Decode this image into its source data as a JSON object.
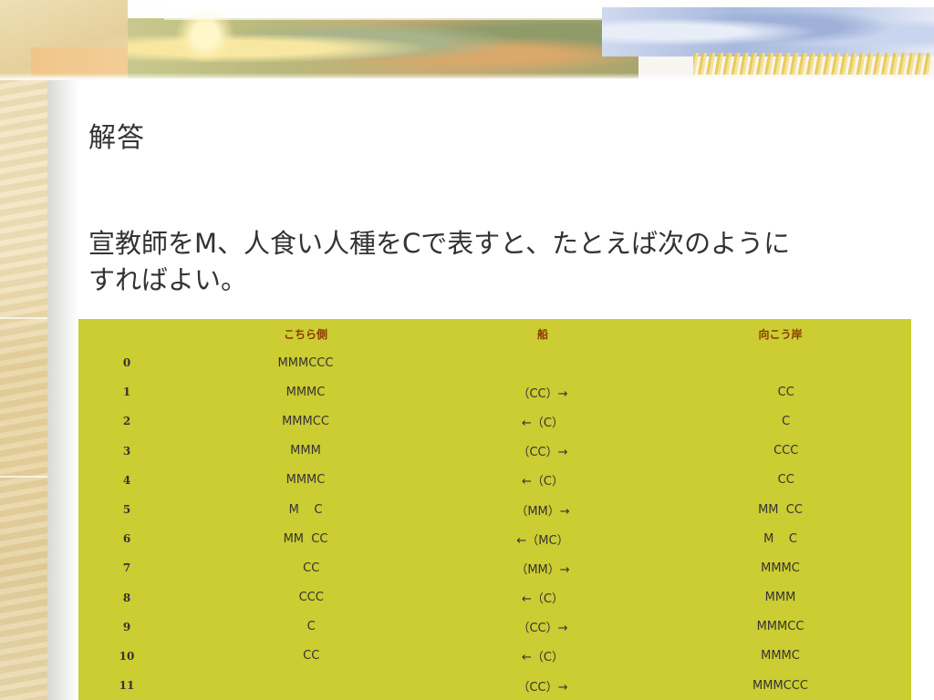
{
  "slide": {
    "title": "解答",
    "body_line1": "宣教師をM、人食い人種をCで表すと、たとえば次のように",
    "body_line2": "すればよい。"
  },
  "table": {
    "headers": [
      "",
      "こちら側",
      "船",
      "向こう岸"
    ],
    "rows": [
      {
        "step": "0",
        "here": "MMMCCC",
        "boat": "",
        "there": ""
      },
      {
        "step": "1",
        "here": "MMMC",
        "boat": "（CC）→",
        "there": "   CC"
      },
      {
        "step": "2",
        "here": "MMMCC",
        "boat": "←（C）",
        "there": "   C"
      },
      {
        "step": "3",
        "here": "MMM",
        "boat": "（CC）→",
        "there": "   CCC"
      },
      {
        "step": "4",
        "here": "MMMC",
        "boat": "←（C）",
        "there": "   CC"
      },
      {
        "step": "5",
        "here": "M    C",
        "boat": "（MM）→",
        "there": "MM  CC"
      },
      {
        "step": "6",
        "here": "MM  CC",
        "boat": "←（MC）",
        "there": "M    C"
      },
      {
        "step": "7",
        "here": "   CC",
        "boat": "（MM）→",
        "there": "MMMC"
      },
      {
        "step": "8",
        "here": "   CCC",
        "boat": "←（C）",
        "there": "MMM"
      },
      {
        "step": "9",
        "here": "   C",
        "boat": "（CC）→",
        "there": "MMMCC"
      },
      {
        "step": "10",
        "here": "   CC",
        "boat": "←（C）",
        "there": "MMMC"
      },
      {
        "step": "11",
        "here": "",
        "boat": "（CC）→",
        "there": "MMMCCC"
      }
    ]
  },
  "colors": {
    "table_bg": "#cccc33",
    "header_text": "#8a3b00",
    "body_text": "#333333"
  }
}
